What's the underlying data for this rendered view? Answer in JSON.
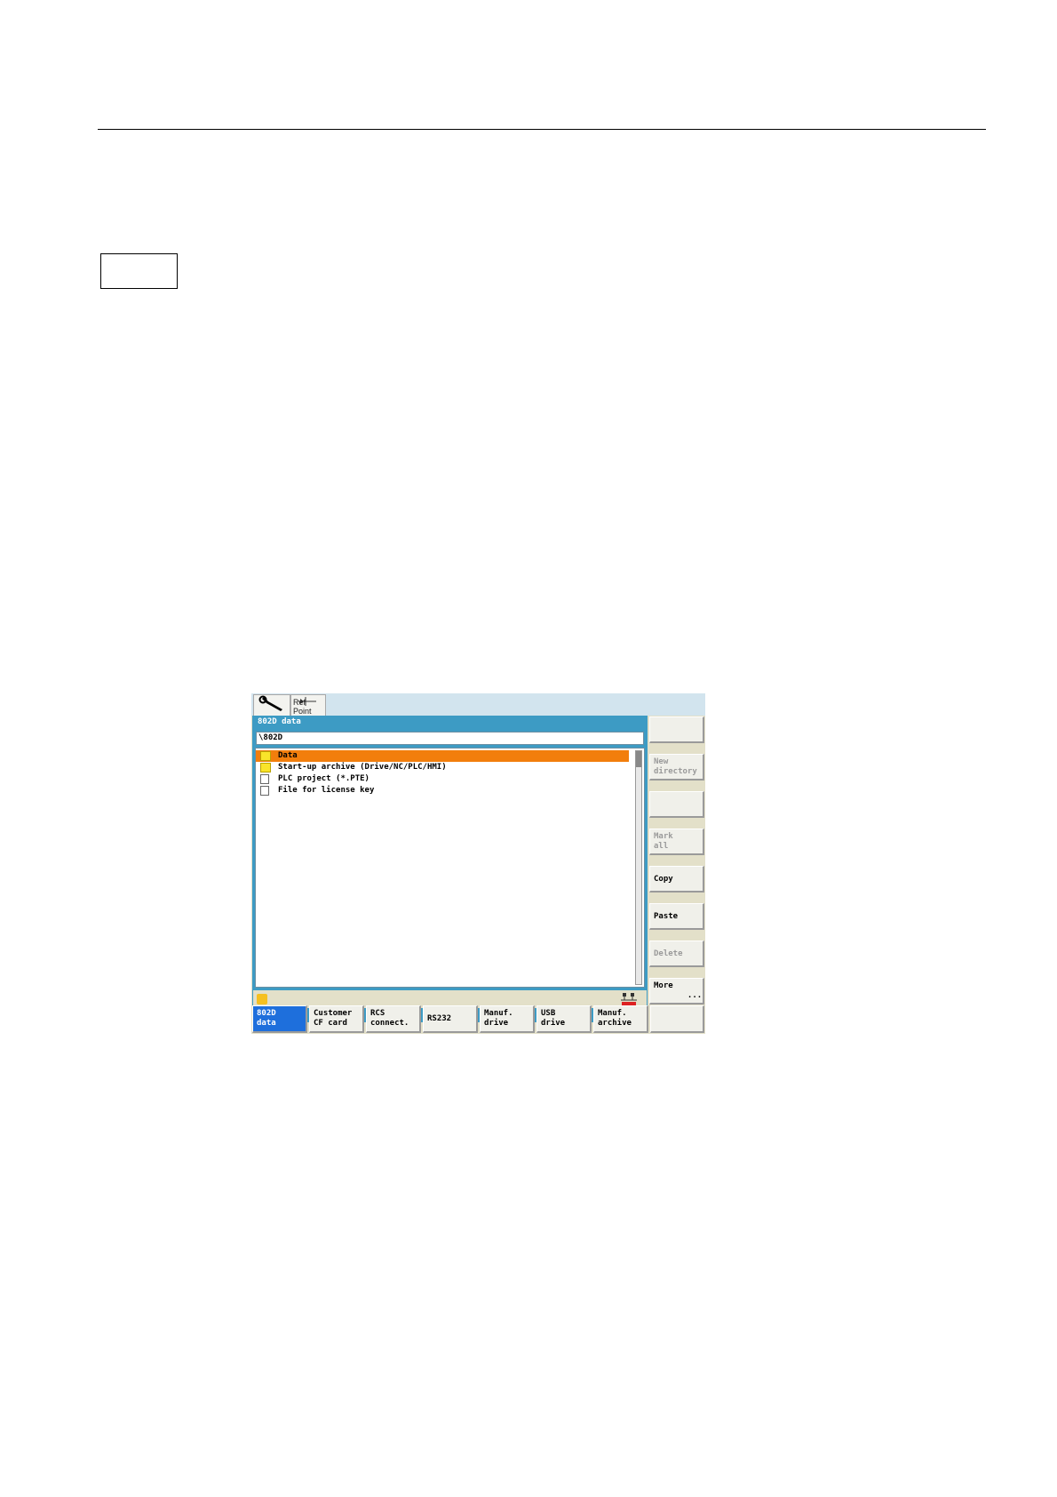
{
  "screen": {
    "top_tabs": {
      "ref_point_label": "Ref Point"
    },
    "window": {
      "title": "802D data",
      "path": "\\802D",
      "items": [
        {
          "label": "Data",
          "icon": "folder-icon",
          "selected": true
        },
        {
          "label": "Start-up archive (Drive/NC/PLC/HMI)",
          "icon": "folder-icon",
          "selected": false
        },
        {
          "label": "PLC project (*.PTE)",
          "icon": "file-icon",
          "selected": false
        },
        {
          "label": "File for license key",
          "icon": "file-icon",
          "selected": false
        }
      ]
    },
    "vertical_softkeys": [
      "",
      "New\ndirectory",
      "",
      "Mark\nall",
      "Copy",
      "Paste",
      "Delete",
      "More\n       ..."
    ],
    "horizontal_softkeys": [
      "802D\ndata",
      "Customer\nCF card",
      "RCS\nconnect.",
      "RS232",
      "Manuf.\ndrive",
      "USB\ndrive",
      "Manuf.\narchive",
      ""
    ],
    "colors": {
      "selection": "#f27e0c",
      "window": "#3d9bc4",
      "active_softkey": "#1e6fdc",
      "background": "#e3e0c9"
    }
  }
}
